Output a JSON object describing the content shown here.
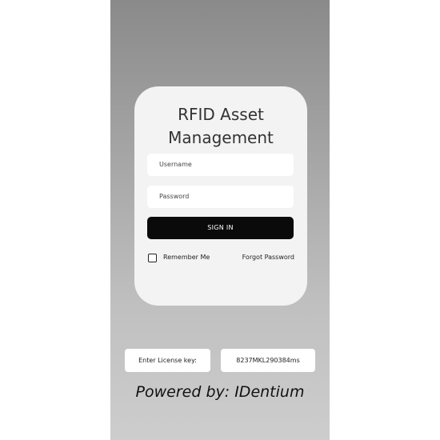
{
  "login": {
    "title_line1": "RFID Asset",
    "title_line2": "Management",
    "username_placeholder": "Username",
    "password_placeholder": "Password",
    "sign_in_label": "SIGN IN",
    "remember_me_label": "Remember Me",
    "remember_me_checked": false,
    "forgot_password_label": "Forgot Password"
  },
  "license": {
    "label": "Enter License key:",
    "value": "8237MKL290384ms"
  },
  "footer": {
    "powered_by": "Powered by: IDentium"
  }
}
